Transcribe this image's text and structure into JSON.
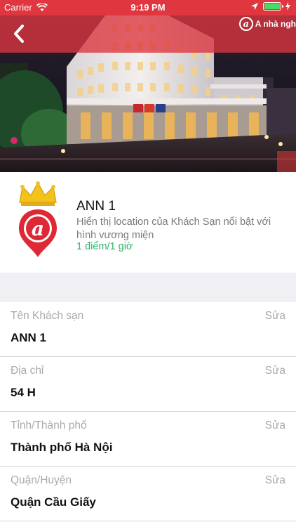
{
  "status_bar": {
    "carrier": "Carrier",
    "time": "9:19 PM",
    "wifi_icon": "wifi-icon",
    "location_icon": "location-arrow-icon",
    "battery_icon": "battery-icon",
    "charging_icon": "charging-bolt-icon",
    "battery_level": 1.0
  },
  "nav": {
    "back_icon": "chevron-left-icon",
    "brand_mark": "a",
    "brand_text": "A nhà ngh"
  },
  "hotel": {
    "name": "ANN 1",
    "description": "Hiển thị location của Khách Sạn nổi bật với hình vương miện",
    "price": "1 điểm/1 giờ",
    "logo_icon": "crown-pin-logo",
    "logo_letter": "a"
  },
  "fields": [
    {
      "label": "Tên Khách sạn",
      "value": "ANN 1",
      "edit": "Sửa"
    },
    {
      "label": "Địa chỉ",
      "value": "54 H",
      "edit": "Sửa"
    },
    {
      "label": "Tỉnh/Thành phố",
      "value": "Thành phố Hà Nội",
      "edit": "Sửa"
    },
    {
      "label": "Quận/Huyện",
      "value": "Quận Cầu Giấy",
      "edit": "Sửa"
    }
  ],
  "colors": {
    "accent_red": "#dd343e",
    "price_green": "#31b56c",
    "muted_label": "#a9a9ae",
    "section_gap": "#efeff4"
  }
}
